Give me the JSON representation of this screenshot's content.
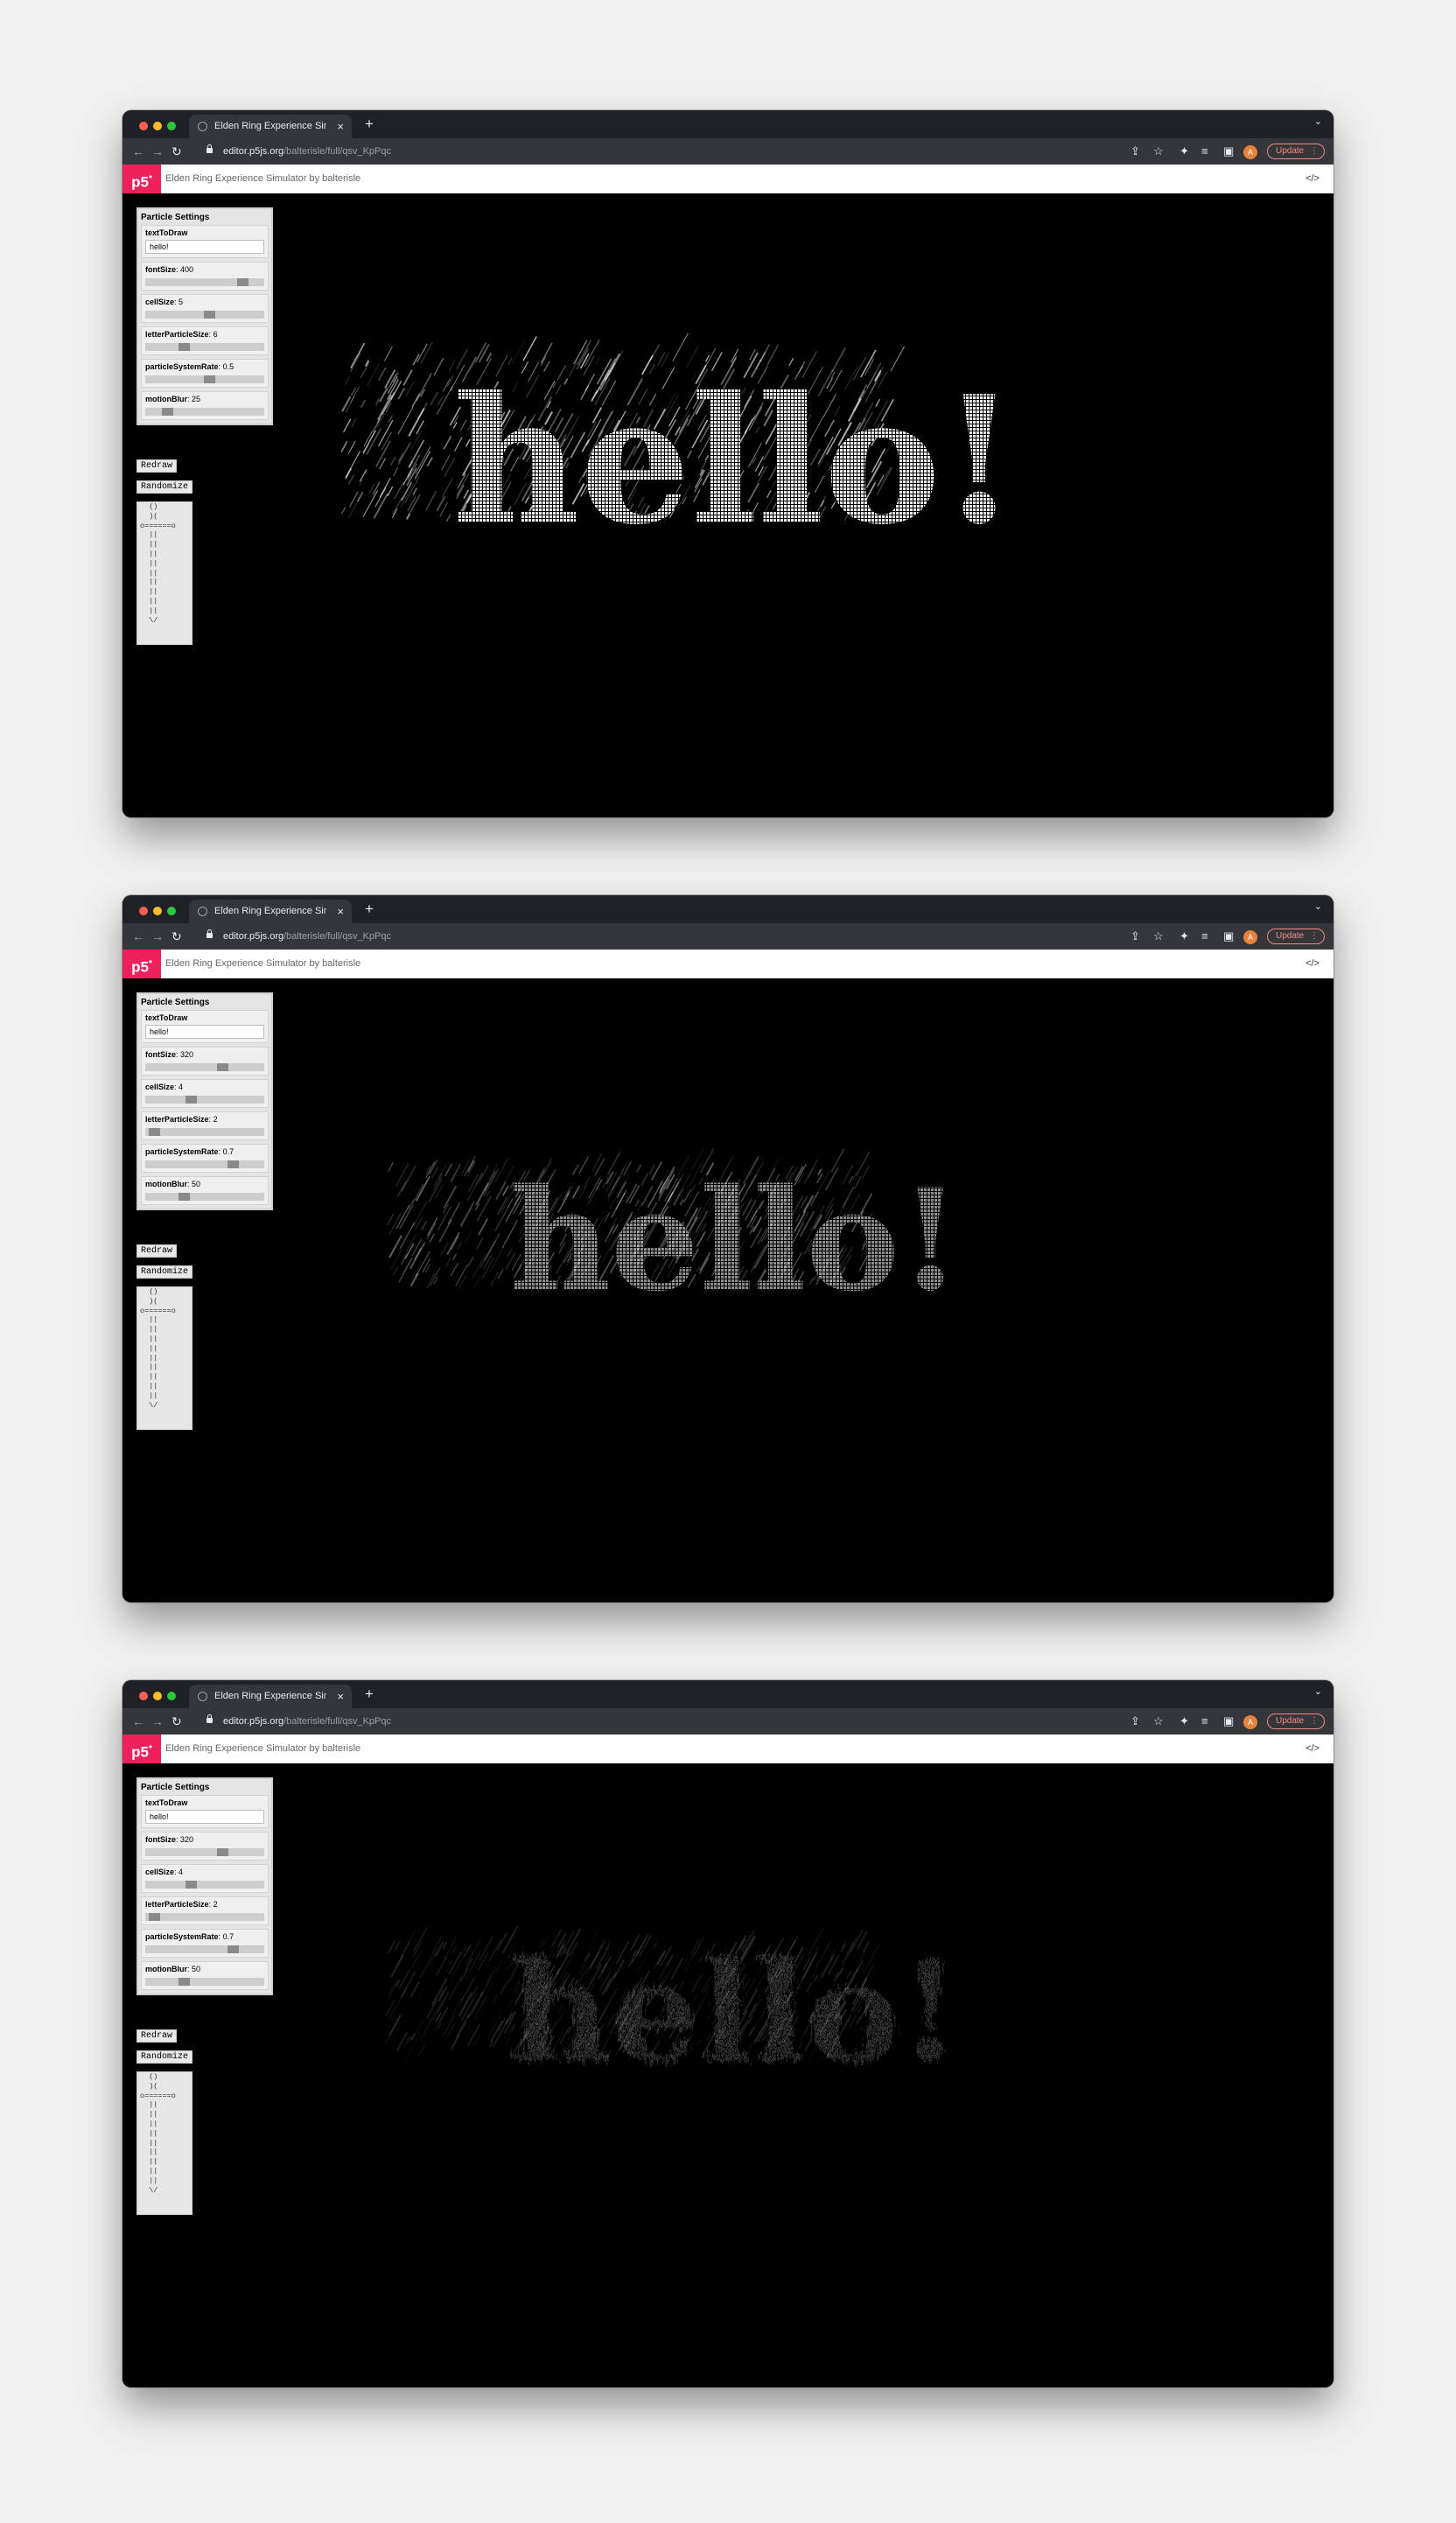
{
  "screens": [
    {
      "tab_title": "Elden Ring Experience Simulator",
      "url_host": "editor.p5js.org",
      "url_path": "/balterisle/full/qsv_KpPqc",
      "sketch_title": "Elden Ring Experience Simulator by balterisle",
      "update_label": "Update",
      "avatar_letter": "A",
      "panel_title": "Particle Settings",
      "text_label": "textToDraw",
      "text_value": "hello!",
      "sliders": [
        {
          "label": "fontSize",
          "value": "400",
          "position": 0.77
        },
        {
          "label": "cellSize",
          "value": "5",
          "position": 0.49
        },
        {
          "label": "letterParticleSize",
          "value": "6",
          "position": 0.28
        },
        {
          "label": "particleSystemRate",
          "value": "0.5",
          "position": 0.49
        },
        {
          "label": "motionBlur",
          "value": "25",
          "position": 0.14
        }
      ],
      "redraw_label": "Redraw",
      "randomize_label": "Randomize",
      "canvas_text": "hello!",
      "text_brightness": 1.0,
      "ascii_sword": "  ()\n  )(\no======o\n  ||\n  ||\n  ||\n  ||\n  ||\n  ||\n  ||\n  ||\n  ||\n  \\/"
    },
    {
      "tab_title": "Elden Ring Experience Simulator",
      "url_host": "editor.p5js.org",
      "url_path": "/balterisle/full/qsv_KpPqc",
      "sketch_title": "Elden Ring Experience Simulator by balterisle",
      "update_label": "Update",
      "avatar_letter": "A",
      "panel_title": "Particle Settings",
      "text_label": "textToDraw",
      "text_value": "hello!",
      "sliders": [
        {
          "label": "fontSize",
          "value": "320",
          "position": 0.6
        },
        {
          "label": "cellSize",
          "value": "4",
          "position": 0.34
        },
        {
          "label": "letterParticleSize",
          "value": "2",
          "position": 0.03
        },
        {
          "label": "particleSystemRate",
          "value": "0.7",
          "position": 0.69
        },
        {
          "label": "motionBlur",
          "value": "50",
          "position": 0.28
        }
      ],
      "redraw_label": "Redraw",
      "randomize_label": "Randomize",
      "canvas_text": "hello!",
      "text_brightness": 0.55,
      "ascii_sword": "  ()\n  )(\no======o\n  ||\n  ||\n  ||\n  ||\n  ||\n  ||\n  ||\n  ||\n  ||\n  \\/"
    },
    {
      "tab_title": "Elden Ring Experience Simulator",
      "url_host": "editor.p5js.org",
      "url_path": "/balterisle/full/qsv_KpPqc",
      "sketch_title": "Elden Ring Experience Simulator by balterisle",
      "update_label": "Update",
      "avatar_letter": "A",
      "panel_title": "Particle Settings",
      "text_label": "textToDraw",
      "text_value": "hello!",
      "sliders": [
        {
          "label": "fontSize",
          "value": "320",
          "position": 0.6
        },
        {
          "label": "cellSize",
          "value": "4",
          "position": 0.34
        },
        {
          "label": "letterParticleSize",
          "value": "2",
          "position": 0.03
        },
        {
          "label": "particleSystemRate",
          "value": "0.7",
          "position": 0.69
        },
        {
          "label": "motionBlur",
          "value": "50",
          "position": 0.28
        }
      ],
      "redraw_label": "Redraw",
      "randomize_label": "Randomize",
      "canvas_text": "hello!",
      "text_brightness": 0.22,
      "ascii_sword": "  ()\n  )(\no======o\n  ||\n  ||\n  ||\n  ||\n  ||\n  ||\n  ||\n  ||\n  ||\n  \\/"
    }
  ],
  "colors": {
    "p5_brand": "#ed225d",
    "update_accent": "#f28b82",
    "avatar": "#e8823a"
  },
  "icons": {
    "close": "×",
    "new_tab": "+",
    "tab_menu": "⌄",
    "back": "←",
    "forward": "→",
    "reload": "↻",
    "share": "⇪",
    "star": "☆",
    "extensions": "✦",
    "queue": "≡",
    "sidebar": "▣",
    "kebab": "⋮",
    "code": "</>"
  }
}
